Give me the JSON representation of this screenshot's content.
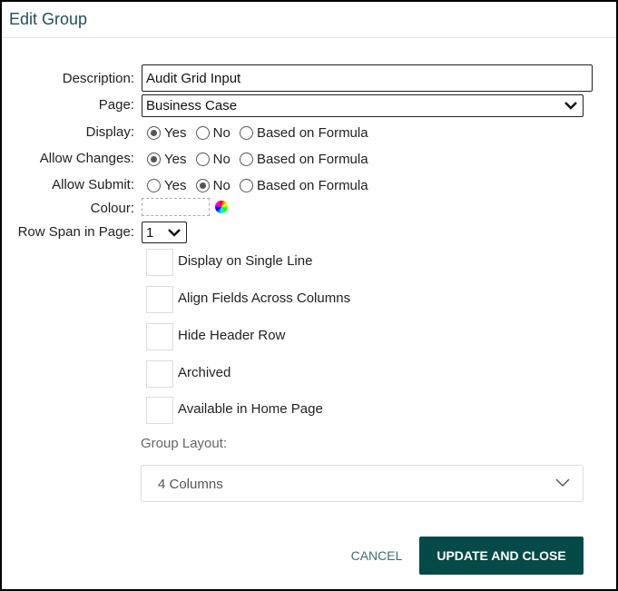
{
  "dialog": {
    "title": "Edit Group"
  },
  "fields": {
    "description": {
      "label": "Description:",
      "value": "Audit Grid Input"
    },
    "page": {
      "label": "Page:",
      "value": "Business Case"
    },
    "display": {
      "label": "Display:",
      "options": [
        "Yes",
        "No",
        "Based on Formula"
      ],
      "selected": "Yes"
    },
    "allow_changes": {
      "label": "Allow Changes:",
      "options": [
        "Yes",
        "No",
        "Based on Formula"
      ],
      "selected": "Yes"
    },
    "allow_submit": {
      "label": "Allow Submit:",
      "options": [
        "Yes",
        "No",
        "Based on Formula"
      ],
      "selected": "No"
    },
    "colour": {
      "label": "Colour:"
    },
    "row_span": {
      "label": "Row Span in Page:",
      "value": "1"
    }
  },
  "checkboxes": [
    {
      "label": "Display on Single Line",
      "checked": false
    },
    {
      "label": "Align Fields Across Columns",
      "checked": false
    },
    {
      "label": "Hide Header Row",
      "checked": false
    },
    {
      "label": "Archived",
      "checked": false
    },
    {
      "label": "Available in Home Page",
      "checked": false
    }
  ],
  "group_layout": {
    "label": "Group Layout:",
    "value": "4 Columns"
  },
  "actions": {
    "cancel": "CANCEL",
    "update": "UPDATE AND CLOSE"
  },
  "colors": {
    "title": "#244f5c",
    "primary_button": "#044a48",
    "cancel_text": "#3d6c7a"
  }
}
